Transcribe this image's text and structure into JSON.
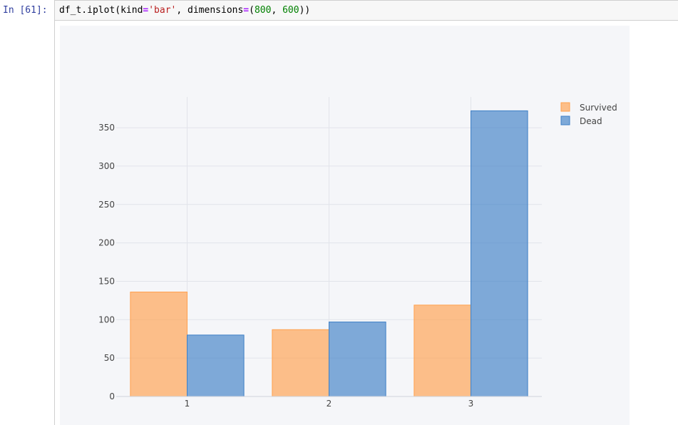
{
  "cell": {
    "prompt": "In [61]:",
    "code_tokens": [
      {
        "text": "df_t.iplot(kind",
        "cls": ""
      },
      {
        "text": "=",
        "cls": "tok-op"
      },
      {
        "text": "'bar'",
        "cls": "tok-str"
      },
      {
        "text": ", dimensions",
        "cls": ""
      },
      {
        "text": "=",
        "cls": "tok-op"
      },
      {
        "text": "(",
        "cls": ""
      },
      {
        "text": "800",
        "cls": "tok-num"
      },
      {
        "text": ", ",
        "cls": ""
      },
      {
        "text": "600",
        "cls": "tok-num"
      },
      {
        "text": "))",
        "cls": ""
      }
    ]
  },
  "chart_data": {
    "type": "bar",
    "categories": [
      "1",
      "2",
      "3"
    ],
    "series": [
      {
        "name": "Survived",
        "values": [
          136,
          87,
          119
        ],
        "color": "#ffa04d"
      },
      {
        "name": "Dead",
        "values": [
          80,
          97,
          372
        ],
        "color": "#3d7fc6"
      }
    ],
    "ylim": [
      0,
      390
    ],
    "yticks": [
      0,
      50,
      100,
      150,
      200,
      250,
      300,
      350
    ],
    "grid": true,
    "legend_position": "top-right",
    "title": "",
    "xlabel": "",
    "ylabel": ""
  }
}
